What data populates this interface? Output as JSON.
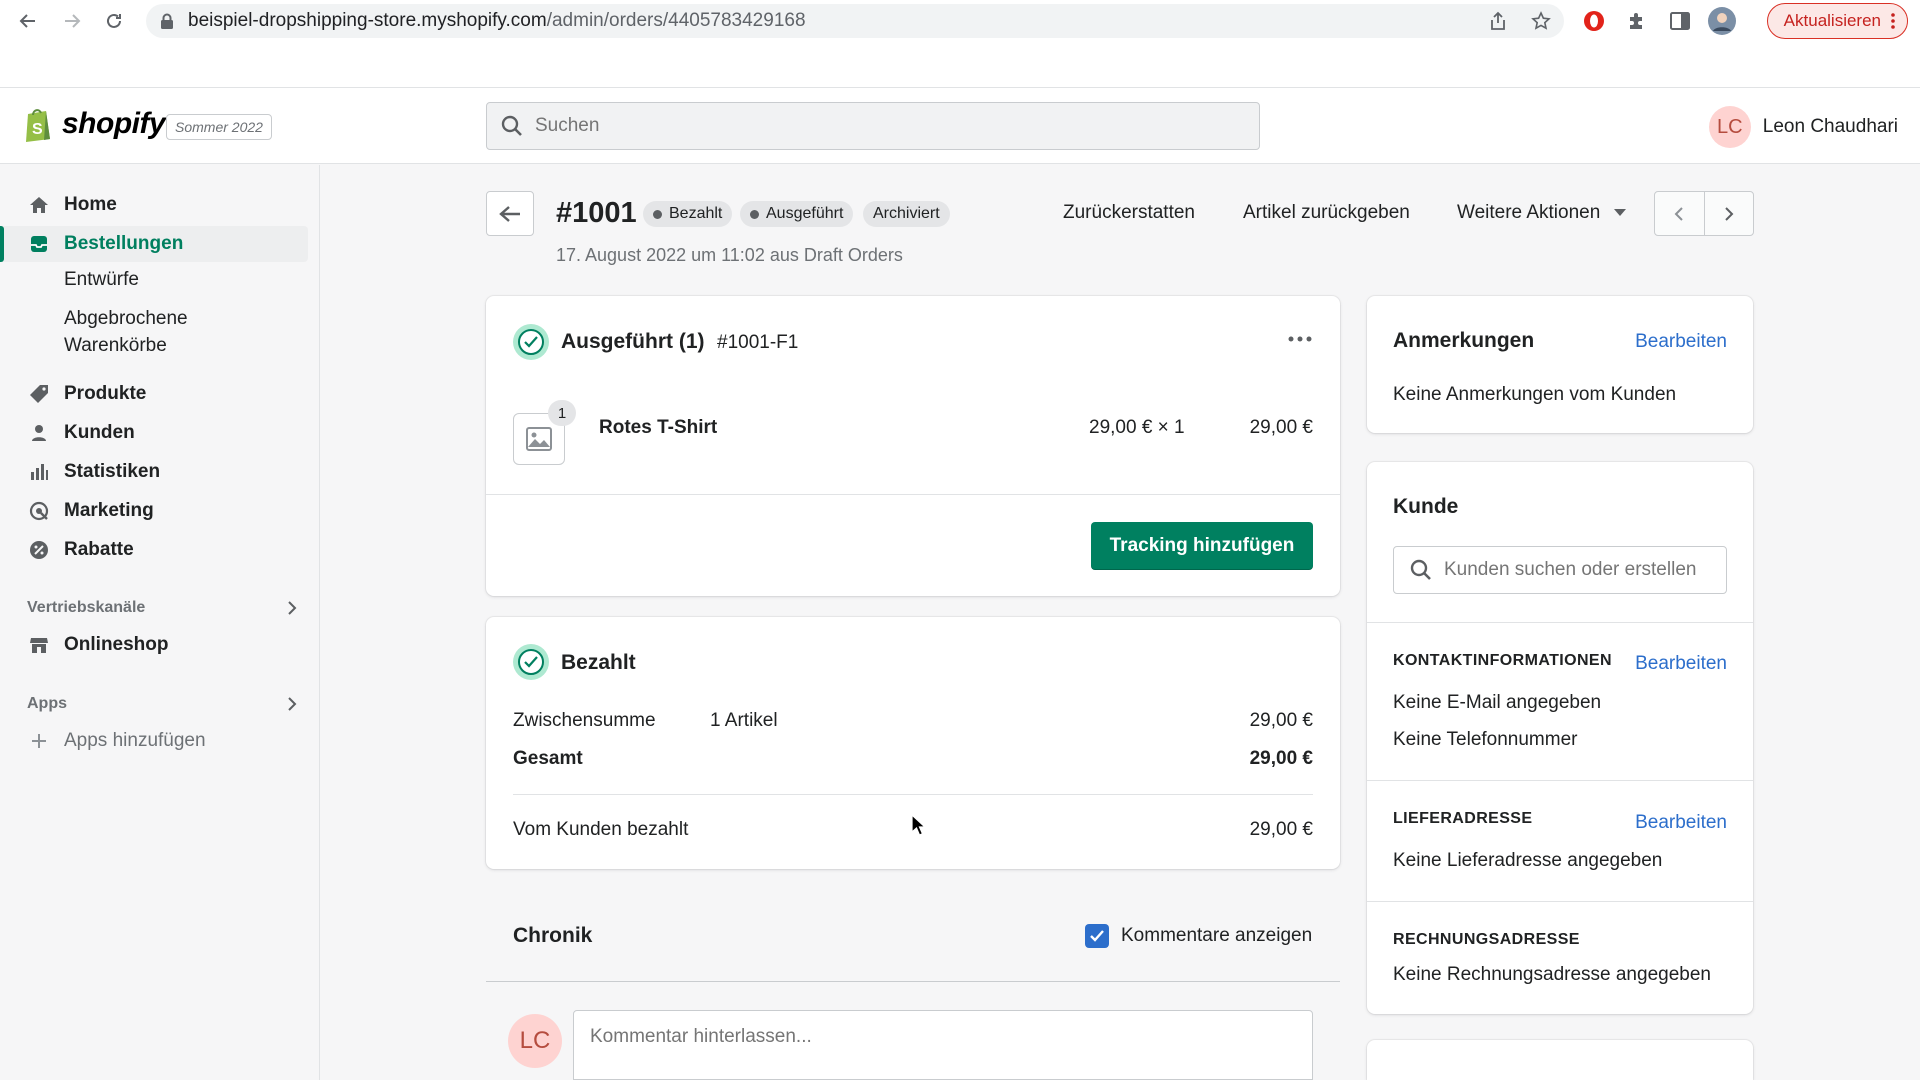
{
  "browser": {
    "url_host": "beispiel-dropshipping-store.myshopify.com",
    "url_path": "/admin/orders/4405783429168",
    "update_label": "Aktualisieren"
  },
  "topbar": {
    "logo_text": "shopify",
    "edition": "Sommer 2022",
    "search_placeholder": "Suchen",
    "user_initials": "LC",
    "user_name": "Leon Chaudhari"
  },
  "sidebar": {
    "items": [
      {
        "label": "Home",
        "icon": "home-icon"
      },
      {
        "label": "Bestellungen",
        "icon": "orders-icon",
        "active": true
      },
      {
        "label": "Produkte",
        "icon": "tag-icon"
      },
      {
        "label": "Kunden",
        "icon": "person-icon"
      },
      {
        "label": "Statistiken",
        "icon": "bar-chart-icon"
      },
      {
        "label": "Marketing",
        "icon": "marketing-icon"
      },
      {
        "label": "Rabatte",
        "icon": "discount-icon"
      }
    ],
    "sub_drafts": "Entwürfe",
    "sub_abandoned_1": "Abgebrochene",
    "sub_abandoned_2": "Warenkörbe",
    "sales_channels": "Vertriebskanäle",
    "online_store": "Onlineshop",
    "apps": "Apps",
    "add_apps": "Apps hinzufügen"
  },
  "header": {
    "order_number": "#1001",
    "badges": [
      "Bezahlt",
      "Ausgeführt",
      "Archiviert"
    ],
    "meta": "17. August 2022 um 11:02 aus Draft Orders",
    "refund": "Zurückerstatten",
    "return_items": "Artikel zurückgeben",
    "more_actions": "Weitere Aktionen"
  },
  "fulfilled_card": {
    "title": "Ausgeführt (1)",
    "fulfillment_id": "#1001-F1",
    "item_name": "Rotes T-Shirt",
    "item_qty_badge": "1",
    "unit_price": "29,00 € × 1",
    "line_total": "29,00 €",
    "tracking_button": "Tracking hinzufügen"
  },
  "paid_card": {
    "title": "Bezahlt",
    "subtotal_label": "Zwischensumme",
    "subtotal_items": "1 Artikel",
    "subtotal_value": "29,00 €",
    "total_label": "Gesamt",
    "total_value": "29,00 €",
    "paid_by_customer_label": "Vom Kunden bezahlt",
    "paid_by_customer_value": "29,00 €"
  },
  "timeline": {
    "title": "Chronik",
    "show_comments": "Kommentare anzeigen",
    "comment_placeholder": "Kommentar hinterlassen...",
    "avatar_initials": "LC"
  },
  "notes_card": {
    "title": "Anmerkungen",
    "edit": "Bearbeiten",
    "empty": "Keine Anmerkungen vom Kunden"
  },
  "customer_card": {
    "title": "Kunde",
    "search_placeholder": "Kunden suchen oder erstellen",
    "contact_head": "KONTAKTINFORMATIONEN",
    "contact_edit": "Bearbeiten",
    "no_email": "Keine E-Mail angegeben",
    "no_phone": "Keine Telefonnummer",
    "shipping_head": "LIEFERADRESSE",
    "shipping_edit": "Bearbeiten",
    "no_shipping": "Keine Lieferadresse angegeben",
    "billing_head": "RECHNUNGSADRESSE",
    "no_billing": "Keine Rechnungsadresse angegeben"
  },
  "colors": {
    "accent_green": "#008060",
    "link_blue": "#2c6ecb",
    "badge_gray": "#e4e5e7"
  }
}
